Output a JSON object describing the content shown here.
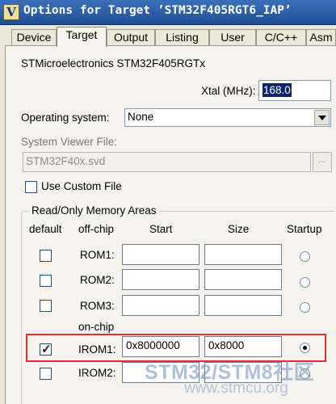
{
  "window": {
    "title": "Options for Target ’STM32F405RGT6_IAP’"
  },
  "tabs": [
    "Device",
    "Target",
    "Output",
    "Listing",
    "User",
    "C/C++",
    "Asm"
  ],
  "active_tab": "Target",
  "device_name": "STMicroelectronics STM32F405RGTx",
  "xtal": {
    "label": "Xtal (MHz):",
    "value": "168.0"
  },
  "os": {
    "label": "Operating system:",
    "value": "None"
  },
  "svd": {
    "label": "System Viewer File:",
    "value": "STM32F40x.svd",
    "browse": "..."
  },
  "custom_file": {
    "label": "Use Custom File",
    "checked": false
  },
  "ro_memory": {
    "title": "Read/Only Memory Areas",
    "headers": {
      "default": "default",
      "offchip": "off-chip",
      "start": "Start",
      "size": "Size",
      "startup": "Startup"
    },
    "onchip_label": "on-chip",
    "rows": [
      {
        "name": "ROM1:",
        "default": false,
        "start": "",
        "size": "",
        "startup": false
      },
      {
        "name": "ROM2:",
        "default": false,
        "start": "",
        "size": "",
        "startup": false
      },
      {
        "name": "ROM3:",
        "default": false,
        "start": "",
        "size": "",
        "startup": false
      },
      {
        "name": "IROM1:",
        "default": true,
        "start": "0x8000000",
        "size": "0x8000",
        "startup": true
      },
      {
        "name": "IROM2:",
        "default": false,
        "start": "",
        "size": "",
        "startup": false
      }
    ]
  },
  "watermark": {
    "line1": "STM32/STM8社区",
    "line2": "www.stmcu.org"
  },
  "colors": {
    "highlight": "#e0322c",
    "titlebar": "#2b5da6",
    "selection": "#0a246a"
  }
}
